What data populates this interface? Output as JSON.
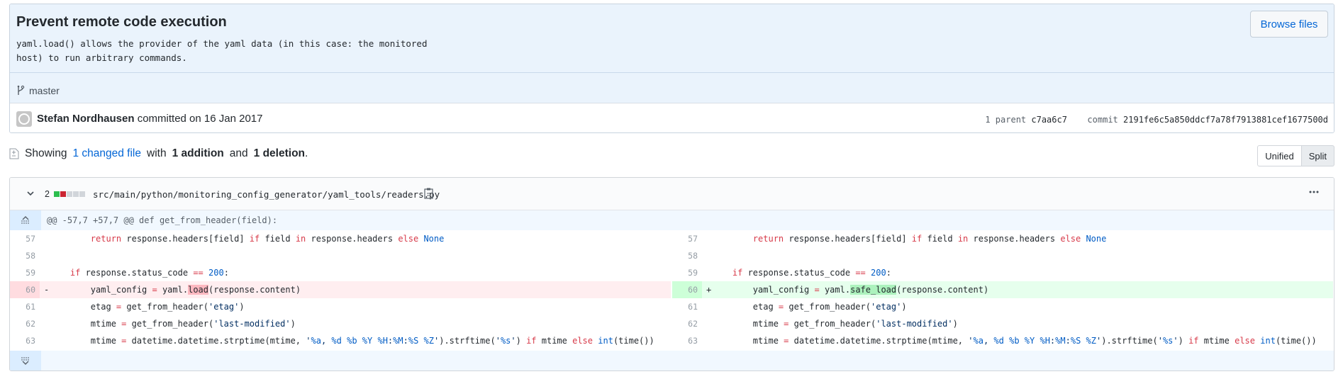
{
  "commit": {
    "title": "Prevent remote code execution",
    "description": "yaml.load() allows the provider of the yaml data (in this case: the monitored\nhost) to run arbitrary commands.",
    "browse_files_label": "Browse files",
    "branch": "master",
    "author": "Stefan Nordhausen",
    "committed_text": "committed on 16 Jan 2017",
    "parent_label": "1 parent",
    "parent_sha": "c7aa6c7",
    "commit_label": "commit",
    "commit_sha": "2191fe6c5a850ddcf7a78f7913881cef1677500d"
  },
  "summary": {
    "prefix": "Showing",
    "changed_files": "1 changed file",
    "with_text": "with",
    "additions": "1 addition",
    "and_text": "and",
    "deletions": "1 deletion",
    "period": "."
  },
  "view_toggle": {
    "unified_label": "Unified",
    "split_label": "Split",
    "selected": "Split"
  },
  "file": {
    "change_count": "2",
    "path": "src/main/python/monitoring_config_generator/yaml_tools/readers.py",
    "hunk_header": "@@ -57,7 +57,7 @@ def get_from_header(field):",
    "diffstat_colors": {
      "added": "#2cbe4e",
      "deleted": "#cb2431",
      "neutral": "#d1d5da"
    }
  },
  "diff_lines": [
    {
      "left_num": "57",
      "right_num": "57",
      "type": "context"
    },
    {
      "left_num": "58",
      "right_num": "58",
      "type": "context"
    },
    {
      "left_num": "59",
      "right_num": "59",
      "type": "context"
    },
    {
      "left_num": "60",
      "right_num": "60",
      "type": "change",
      "left_marker": "-",
      "right_marker": "+"
    },
    {
      "left_num": "61",
      "right_num": "61",
      "type": "context"
    },
    {
      "left_num": "62",
      "right_num": "62",
      "type": "context"
    },
    {
      "left_num": "63",
      "right_num": "63",
      "type": "context"
    }
  ],
  "code": {
    "l57_a": "        ",
    "l57_return": "return",
    "l57_b": " response.headers[field] ",
    "l57_if": "if",
    "l57_c": " field ",
    "l57_in": "in",
    "l57_d": " response.headers ",
    "l57_else": "else",
    "l57_e": " ",
    "l57_none": "None",
    "l59_a": "    ",
    "l59_if": "if",
    "l59_b": " response.status_code ",
    "l59_eq": "==",
    "l59_c": " ",
    "l59_num": "200",
    "l59_d": ":",
    "l60_a": "        yaml_config ",
    "l60_eq": "=",
    "l60_b": " yaml.",
    "l60_del": "load",
    "l60_add": "safe_load",
    "l60_c": "(response.content)",
    "l61_a": "        etag ",
    "l61_eq": "=",
    "l61_b": " get_from_header(",
    "l61_str": "'etag'",
    "l61_c": ")",
    "l62_a": "        mtime ",
    "l62_eq": "=",
    "l62_b": " get_from_header(",
    "l62_str": "'last-modified'",
    "l62_c": ")",
    "l63_a": "        mtime ",
    "l63_eq": "=",
    "l63_b": " datetime.datetime.strptime(mtime, ",
    "l63_q1": "'",
    "l63_fa": "%a",
    "l63_s1": ", ",
    "l63_fd": "%d",
    "l63_s2": " ",
    "l63_fb": "%b",
    "l63_s3": " ",
    "l63_fy": "%Y",
    "l63_s4": " ",
    "l63_fh": "%H",
    "l63_s5": ":",
    "l63_fm": "%M",
    "l63_s6": ":",
    "l63_fs": "%S",
    "l63_s7": " ",
    "l63_fz": "%Z",
    "l63_q2": "'",
    "l63_c": ").strftime(",
    "l63_q3": "'",
    "l63_fs2": "%s",
    "l63_q4": "'",
    "l63_d": ") ",
    "l63_if": "if",
    "l63_e": " mtime ",
    "l63_else": "else",
    "l63_f": " ",
    "l63_int": "int",
    "l63_g": "(time())"
  },
  "icons": {
    "branch": "git-branch-icon",
    "file": "file-diff-icon",
    "chevron": "chevron-down-icon",
    "clipboard": "clipboard-icon",
    "kebab": "kebab-horizontal-icon",
    "expand_up": "expand-up-icon",
    "expand_down": "expand-down-icon"
  },
  "colors": {
    "link": "#0366d6",
    "header_bg": "#eaf3fc",
    "deleted_bg": "#ffeef0",
    "added_bg": "#e6ffed",
    "keyword": "#d73a49",
    "constant": "#005cc5"
  }
}
